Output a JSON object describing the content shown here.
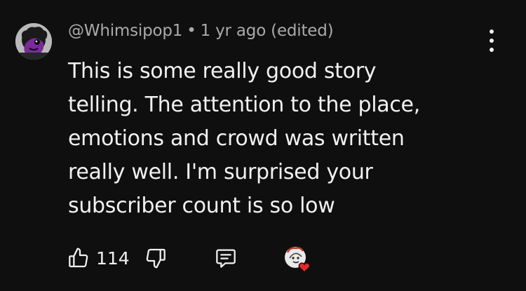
{
  "comment": {
    "author": "@Whimsipop1",
    "separator": "•",
    "timestamp": "1 yr ago (edited)",
    "text": "This is some really good story\ntelling. The attention to the place,\nemotions and crowd was written\nreally well. I'm surprised your\nsubscriber count is so low",
    "likes": "114"
  },
  "icons": {
    "avatar": "cartoon-avatar",
    "menu": "more-vertical-icon",
    "like": "thumbs-up-icon",
    "dislike": "thumbs-down-icon",
    "reply": "comment-icon",
    "heart": "creator-heart-icon"
  },
  "colors": {
    "background": "#0f0f0f",
    "text_primary": "#f1f1f1",
    "text_secondary": "#aaaaaa",
    "avatar_purple": "#7a2a9a",
    "heart_red": "#e02a2a"
  }
}
